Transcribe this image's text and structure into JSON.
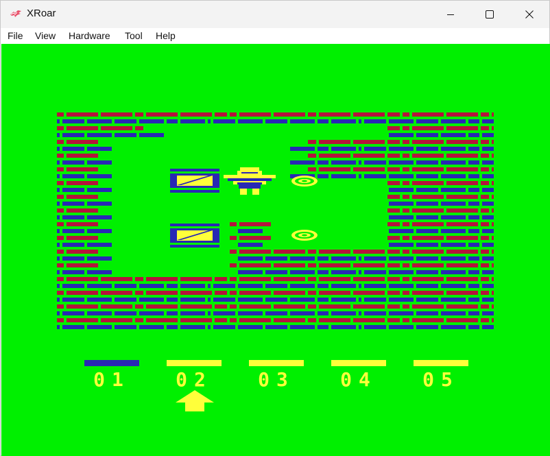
{
  "window": {
    "title": "XRoar",
    "app_icon": "xroar-bird-icon",
    "controls": [
      "minimize-icon",
      "maximize-icon",
      "close-icon"
    ]
  },
  "menu": {
    "items": [
      {
        "label": "File"
      },
      {
        "label": "View"
      },
      {
        "label": "Hardware"
      },
      {
        "label": "Tool"
      },
      {
        "label": "Help"
      }
    ]
  },
  "game": {
    "colors": {
      "background": "#00f000",
      "brick_red": "#b4143c",
      "brick_blue": "#2828b4",
      "yellow": "#ffff3a"
    },
    "levels": [
      {
        "label": "01",
        "completed": true,
        "selected": false
      },
      {
        "label": "02",
        "completed": false,
        "selected": true
      },
      {
        "label": "03",
        "completed": false,
        "selected": false
      },
      {
        "label": "04",
        "completed": false,
        "selected": false
      },
      {
        "label": "05",
        "completed": false,
        "selected": false
      }
    ],
    "selector_icon": "up-arrow-icon"
  }
}
